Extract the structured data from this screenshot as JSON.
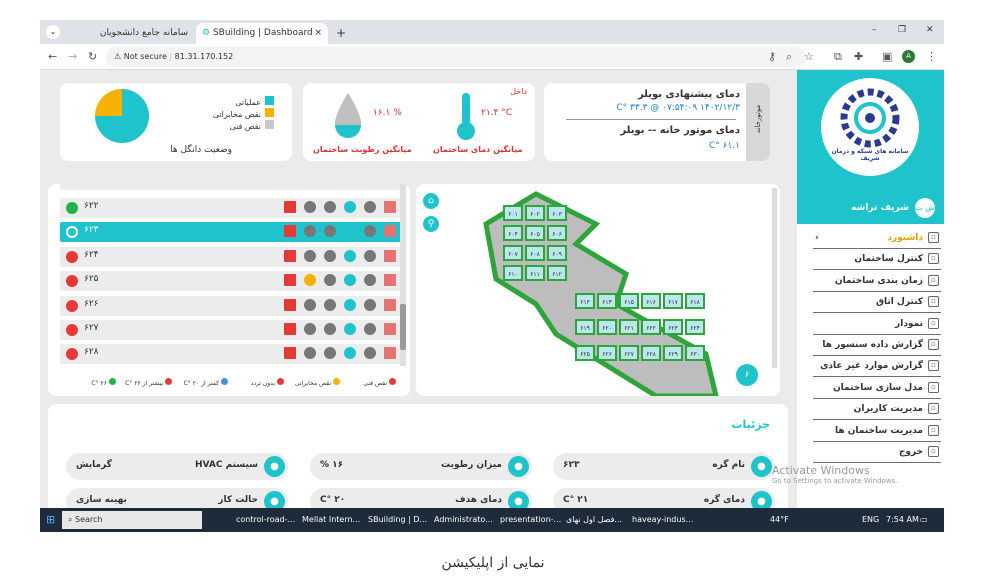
{
  "browser": {
    "tabs": [
      {
        "label": "سامانه جامع دانشجویان",
        "close": "×"
      },
      {
        "label": "SBuilding | Dashboard",
        "close": "×"
      }
    ],
    "new_tab": "+",
    "not_secure": "Not secure",
    "url": "81.31.170.152",
    "profile": "A",
    "window_controls": [
      "–",
      "❐",
      "✕"
    ]
  },
  "sidebar": {
    "logo_text": "سامانه های شبکه و درمان شریف",
    "user_initials": "ش ت",
    "user_name": "شریف تراشه",
    "items": [
      {
        "label": "داشبورد",
        "icon": "grid-icon",
        "active": true
      },
      {
        "label": "کنترل ساختمان",
        "icon": "sliders-icon"
      },
      {
        "label": "زمان بندی ساختمان",
        "icon": "calendar-icon"
      },
      {
        "label": "کنترل اتاق",
        "icon": "room-icon"
      },
      {
        "label": "نمودار",
        "icon": "chart-icon"
      },
      {
        "label": "گزارش داده سنسور ها",
        "icon": "table-icon"
      },
      {
        "label": "گزارش موارد غیر عادی",
        "icon": "alert-icon"
      },
      {
        "label": "مدل سازی ساختمان",
        "icon": "gear-icon"
      },
      {
        "label": "مدیریت کاربران",
        "icon": "user-icon"
      },
      {
        "label": "مدیریت ساختمان ها",
        "icon": "building-icon"
      },
      {
        "label": "خروج",
        "icon": "logout-icon"
      }
    ]
  },
  "boiler": {
    "side_tab": "موتورخانه",
    "title": "دمای پیشنهادی بویلر",
    "datetime": "۱۴۰۲/۱۲/۳ ۰۷:۵۴:۰۹ @ ۳۳.۳ °C",
    "motor_title": "دمای موتور خانه -- بویلر",
    "motor_value": "۶۱.۱ °C"
  },
  "indoor": {
    "label": "داخل",
    "temp_value": "۲۱.۴ °C",
    "temp_caption": "میانگین دمای ساختمان",
    "humidity_value": "۱۶.۱ %",
    "humidity_caption": "میانگین رطوبت ساختمان"
  },
  "status": {
    "caption": "وضعیت دانگل ها",
    "legend": [
      {
        "label": "عملیاتی",
        "color": "#1fc3cb"
      },
      {
        "label": "نقص مخابراتی",
        "color": "#f5b300"
      },
      {
        "label": "نقص فنی",
        "color": "#c8c8c8"
      }
    ],
    "chart_data": {
      "type": "pie",
      "slices": [
        {
          "label": "عملیاتی",
          "value": 75
        },
        {
          "label": "نقص مخابراتی",
          "value": 25
        },
        {
          "label": "نقص فنی",
          "value": 0
        }
      ]
    }
  },
  "rooms": {
    "rows": [
      {
        "name": "۶۲۲",
        "warn": false
      },
      {
        "name": "۶۲۳",
        "warn": false,
        "selected": true
      },
      {
        "name": "۶۲۴",
        "warn": false
      },
      {
        "name": "۶۲۵",
        "warn": true
      },
      {
        "name": "۶۲۶",
        "warn": false
      },
      {
        "name": "۶۲۷",
        "warn": false
      },
      {
        "name": "۶۲۸",
        "warn": false
      }
    ],
    "legend": [
      {
        "label": "نقص فنی"
      },
      {
        "label": "نقص مخابراتی"
      },
      {
        "label": "بدون تردد"
      },
      {
        "label": "کمتر از ۲۰ °C"
      },
      {
        "label": "بیشتر از ۲۶ °C"
      },
      {
        "label": "۲۶ °C"
      }
    ]
  },
  "floor": {
    "badge": "۶",
    "rooms": [
      "۶۰۱",
      "۶۰۲",
      "۶۰۳",
      "۶۰۴",
      "۶۰۵",
      "۶۰۶",
      "۶۰۷",
      "۶۰۸",
      "۶۰۹",
      "۶۱۰",
      "۶۱۱",
      "۶۱۲",
      "۶۱۳",
      "۶۱۴",
      "۶۱۵",
      "۶۱۶",
      "۶۱۷",
      "۶۱۸",
      "۶۱۹",
      "۶۲۰",
      "۶۲۱",
      "۶۲۲",
      "۶۲۳",
      "۶۲۴",
      "۶۲۵",
      "۶۲۶",
      "۶۲۷",
      "۶۲۸",
      "۶۲۹",
      "۶۳۰"
    ]
  },
  "details": {
    "title": "جزئیات",
    "fields": [
      {
        "label": "نام گره",
        "value": "۶۲۳"
      },
      {
        "label": "میزان رطوبت",
        "value": "۱۶ %"
      },
      {
        "label": "سیستم HVAC",
        "value": "گرمایش"
      },
      {
        "label": "دمای گره",
        "value": "۲۱ °C"
      },
      {
        "label": "دمای هدف",
        "value": "۲۰ °C"
      },
      {
        "label": "حالت کار",
        "value": "بهینه سازی"
      }
    ]
  },
  "watermark": {
    "line1": "Activate Windows",
    "line2": "Go to Settings to activate Windows."
  },
  "taskbar": {
    "search": "Search",
    "apps": [
      "control-road-...",
      "Mellat Intern...",
      "SBuilding | D...",
      "Administrato...",
      "presentation-...",
      "فصل اول نهای...",
      "haveay-indus..."
    ],
    "weather": "44°F",
    "lang": "ENG",
    "time": "7:54 AM"
  },
  "caption": "نمایی از اپلیکیشن"
}
